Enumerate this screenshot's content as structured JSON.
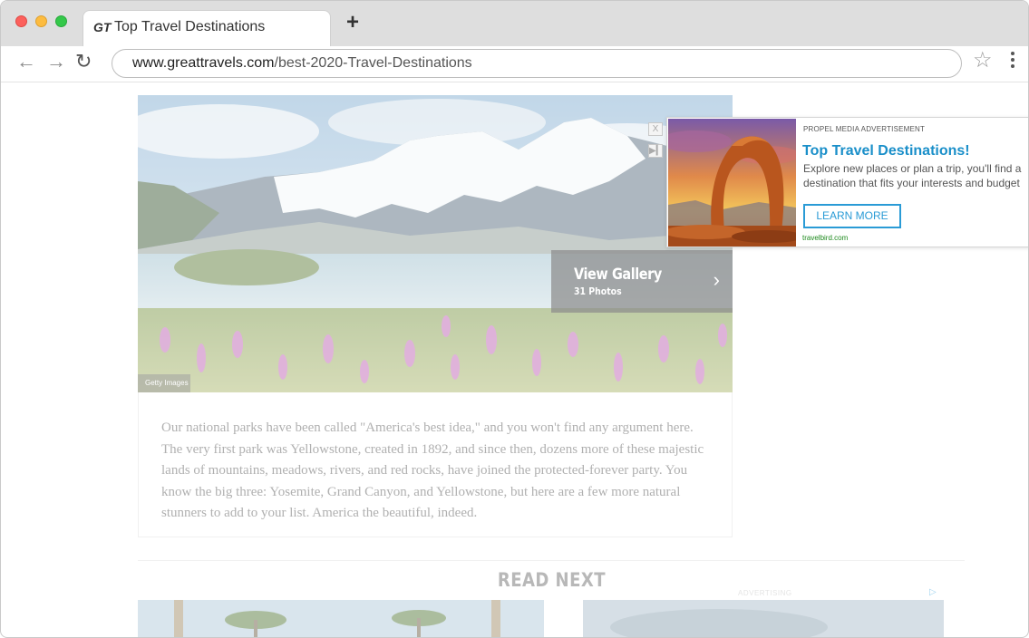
{
  "browser": {
    "tab": {
      "logo": "GT",
      "title": "Top Travel Destinations"
    },
    "new_tab": "+",
    "address": {
      "host": "www.greattravels.com",
      "path": "/best-2020-Travel-Destinations"
    }
  },
  "hero": {
    "credit": "Getty Images",
    "gallery": {
      "title": "View Gallery",
      "count": "31 Photos"
    },
    "ad_controls": {
      "close": "X",
      "skip": "▶▎"
    }
  },
  "article": {
    "body": "Our national parks have been called \"America's best idea,\" and you won't find any argument here. The very first park was Yellowstone, created in 1892, and since then, dozens more of these majestic lands of mountains, meadows, rivers, and red rocks, have joined the protected-forever party. You know the big three: Yosemite, Grand Canyon, and Yellowstone, but here are a few more natural stunners to add to your list. America the beautiful, indeed."
  },
  "read_next": {
    "heading": "READ NEXT",
    "advertising_label": "ADVERTISING"
  },
  "ad": {
    "label": "PROPEL MEDIA ADVERTISEMENT",
    "title": "Top Travel Destinations!",
    "description": "Explore new places or plan a trip, you'll find a destination that fits your interests and budget",
    "cta": "LEARN MORE",
    "domain": "travelbird.com"
  },
  "colors": {
    "accent": "#1a8fc9",
    "domain_green": "#1e8a1e"
  }
}
